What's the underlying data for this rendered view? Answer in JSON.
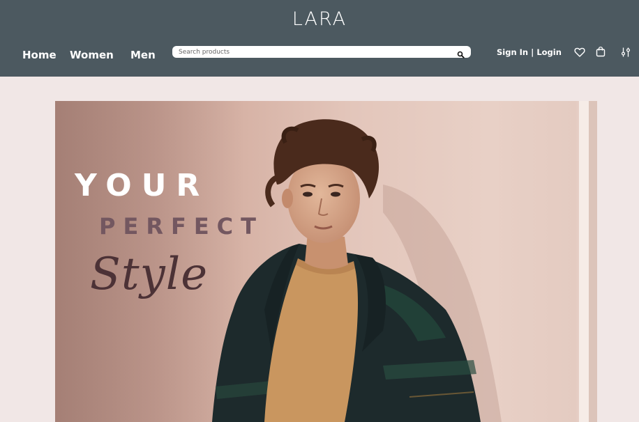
{
  "header": {
    "logo": "LARA",
    "nav": {
      "home": "Home",
      "women": "Women",
      "men": "Men"
    },
    "search": {
      "placeholder": "Search products",
      "value": ""
    },
    "signin_label": "Sign In | Login",
    "icons": [
      "search-icon",
      "heart-icon",
      "shopping-bag-icon",
      "filter-sliders-icon"
    ]
  },
  "hero": {
    "line1": "YOUR",
    "line2": "PERFECT",
    "line3": "Style"
  },
  "colors": {
    "header_bg": "#4c5960",
    "page_bg": "#f1e7e6",
    "perfect_text": "#735760",
    "style_text": "#4c3236"
  }
}
